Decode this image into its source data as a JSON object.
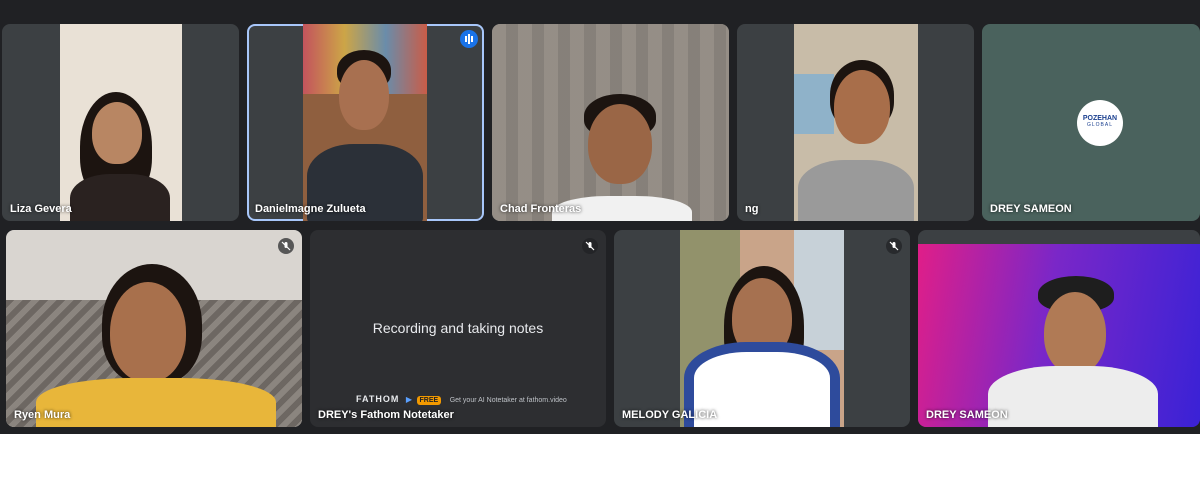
{
  "participants": [
    {
      "name": "Liza Gevera",
      "muted": false
    },
    {
      "name": "Danielmagne Zulueta",
      "muted": false,
      "speaking": true
    },
    {
      "name": "Chad Fronteras",
      "muted": false
    },
    {
      "name": "ng",
      "muted": false
    },
    {
      "name": "DREY SAMEON",
      "muted": false
    },
    {
      "name": "Ryen Mura",
      "muted": true
    },
    {
      "name": "DREY's Fathom Notetaker",
      "muted": true
    },
    {
      "name": "MELODY GALICIA",
      "muted": true
    },
    {
      "name": "DREY SAMEON",
      "muted": true
    }
  ],
  "notetaker": {
    "status": "Recording and taking notes",
    "brand": "FATHOM",
    "badge": "FREE",
    "promo": "Get your AI Notetaker at fathom.video"
  },
  "logo": {
    "line1": "POZEHAN",
    "line2": "GLOBAL"
  },
  "icons": {
    "muted": "mic-off-icon",
    "speaking": "audio-level-icon"
  },
  "colors": {
    "background": "#202124",
    "speaking_outline": "#a8c7fa",
    "fathom_badge": "#f29900"
  }
}
